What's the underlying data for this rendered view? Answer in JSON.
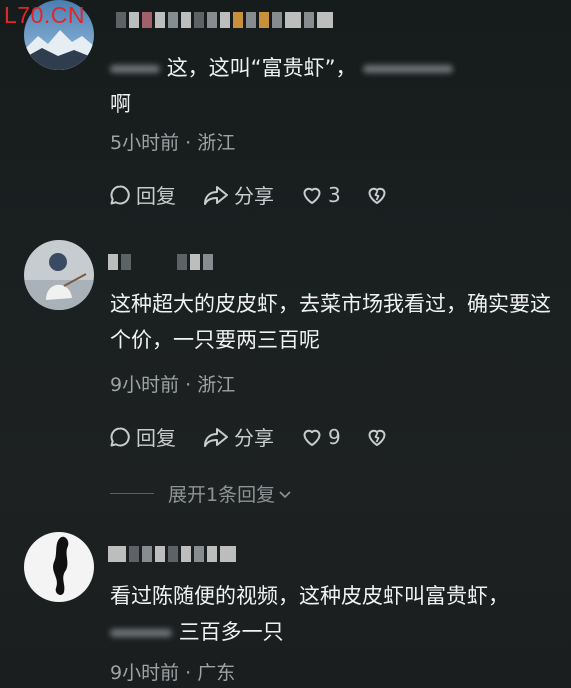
{
  "watermark": "L70.CN",
  "comments": [
    {
      "text_line1": "这，这叫“富贵虾”，",
      "text_line2": "啊",
      "meta": "5小时前 · 浙江",
      "reply_label": "回复",
      "share_label": "分享",
      "likes": "3"
    },
    {
      "text": "这种超大的皮皮虾，去菜市场我看过，确实要这个价，一只要两三百呢",
      "meta": "9小时前 · 浙江",
      "reply_label": "回复",
      "share_label": "分享",
      "likes": "9",
      "expand_label": "展开1条回复"
    },
    {
      "text_line1": "看过陈随便的视频，这种皮皮虾叫富贵虾，",
      "text_line2": "三百多一只",
      "meta": "9小时前 · 广东"
    }
  ],
  "colors": {
    "background": "#1a1f20",
    "text": "#f0f1f2",
    "meta": "#9ea3a6",
    "watermark": "#e0262a"
  }
}
